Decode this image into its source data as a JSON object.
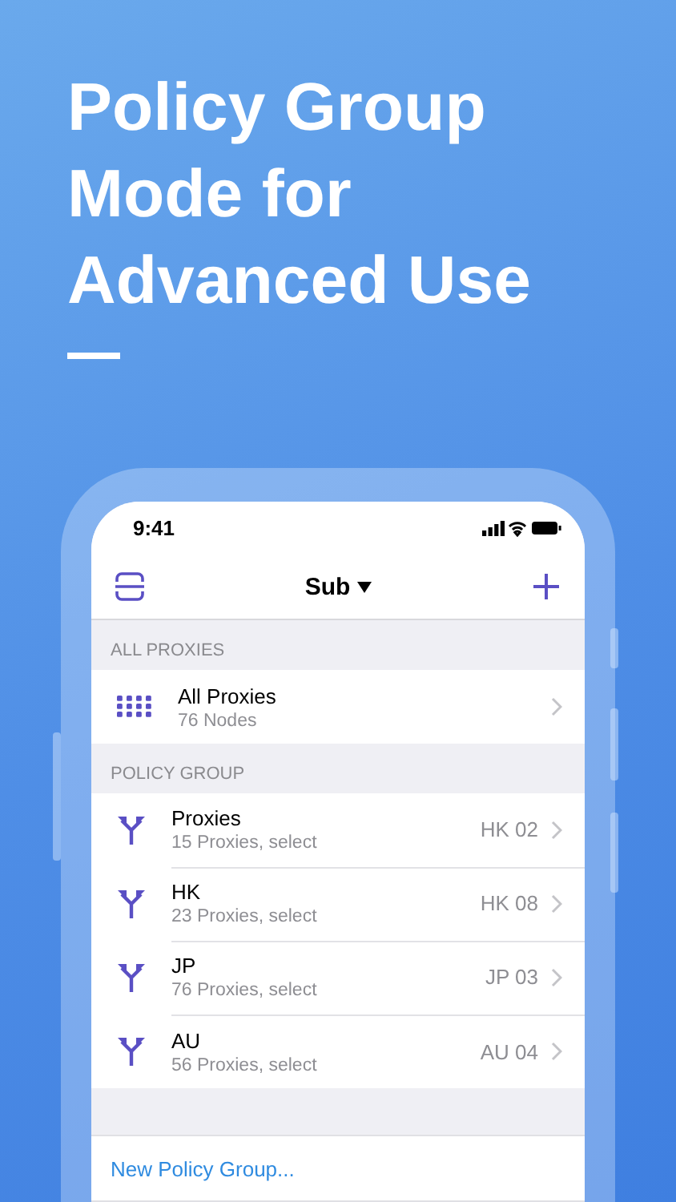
{
  "headline_lines": [
    "Policy Group",
    "Mode for",
    "Advanced Use"
  ],
  "status_bar": {
    "time": "9:41"
  },
  "nav": {
    "title": "Sub"
  },
  "sections": [
    {
      "header": "ALL PROXIES",
      "rows": [
        {
          "kind": "all",
          "title": "All Proxies",
          "subtitle": "76 Nodes"
        }
      ]
    },
    {
      "header": "POLICY GROUP",
      "rows": [
        {
          "kind": "group",
          "title": "Proxies",
          "subtitle": "15 Proxies, select",
          "value": "HK 02"
        },
        {
          "kind": "group",
          "title": "HK",
          "subtitle": "23 Proxies, select",
          "value": "HK 08"
        },
        {
          "kind": "group",
          "title": "JP",
          "subtitle": "76 Proxies, select",
          "value": "JP 03"
        },
        {
          "kind": "group",
          "title": "AU",
          "subtitle": "56 Proxies, select",
          "value": "AU 04"
        }
      ]
    }
  ],
  "action": {
    "label": "New Policy Group..."
  }
}
